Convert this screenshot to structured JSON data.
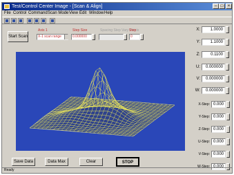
{
  "window": {
    "title": "Test/Control Center Image - [Scan & Align]"
  },
  "menu": [
    "File",
    "Control",
    "Command",
    "Scan Mode",
    "View",
    "Edit",
    "Window",
    "Help"
  ],
  "toolbar": {
    "icons": [
      "open-icon",
      "save-icon",
      "print-icon",
      "scan-icon",
      "plot-icon",
      "zoom-icon",
      "help-icon"
    ]
  },
  "top_controls": {
    "start_scan_label": "Start Scan",
    "labels": [
      "Axis 1",
      "Step Size",
      "Spacing Step Vary Points",
      "Step"
    ],
    "fields": [
      "X-1 scan range",
      "0.000000",
      "",
      "0"
    ]
  },
  "buttons": {
    "save_data": "Save Data",
    "data_max": "Data Max",
    "clear": "Clear",
    "stop": "STOP"
  },
  "axes": [
    {
      "label": "X:",
      "value": "1.0000"
    },
    {
      "label": "Y:",
      "value": "1.1000"
    },
    {
      "label": "Z:",
      "value": "0.1100"
    },
    {
      "label": "U:",
      "value": "0.000000"
    },
    {
      "label": "V:",
      "value": "0.000000"
    },
    {
      "label": "W:",
      "value": "0.000000"
    }
  ],
  "steps": [
    {
      "label": "X-Step:",
      "value": "0.000"
    },
    {
      "label": "Y-Step:",
      "value": "0.000"
    },
    {
      "label": "Z-Step:",
      "value": "0.000"
    },
    {
      "label": "U-Step:",
      "value": "0.000"
    },
    {
      "label": "V-Step:",
      "value": "0.000"
    },
    {
      "label": "W-Step:",
      "value": "0.000"
    }
  ],
  "status": "Ready",
  "colors": {
    "plot_bg": "#2a47b8",
    "surface": "#e8e35a",
    "title_bar": "#0a2a8a"
  }
}
